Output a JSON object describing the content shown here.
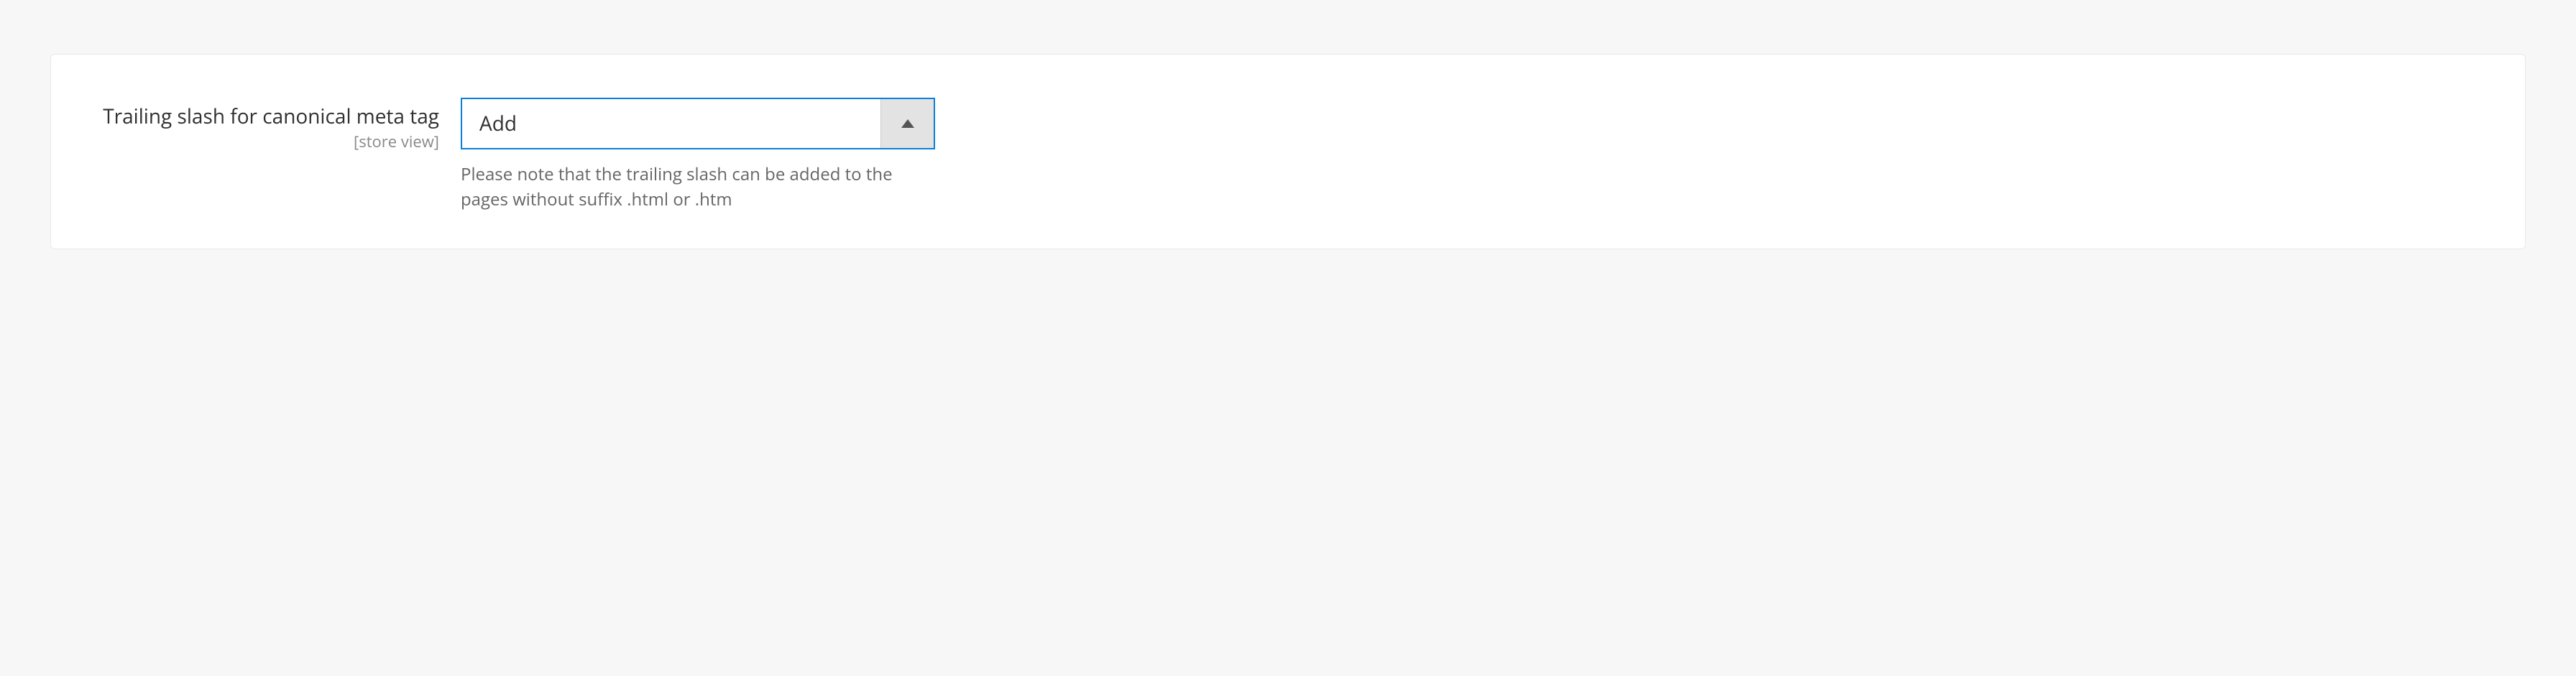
{
  "field": {
    "label": "Trailing slash for canonical meta tag",
    "scope": "[store view]",
    "selected_value": "Add",
    "help_text": "Please note that the trailing slash can be added to the pages without suffix .html or .htm"
  }
}
